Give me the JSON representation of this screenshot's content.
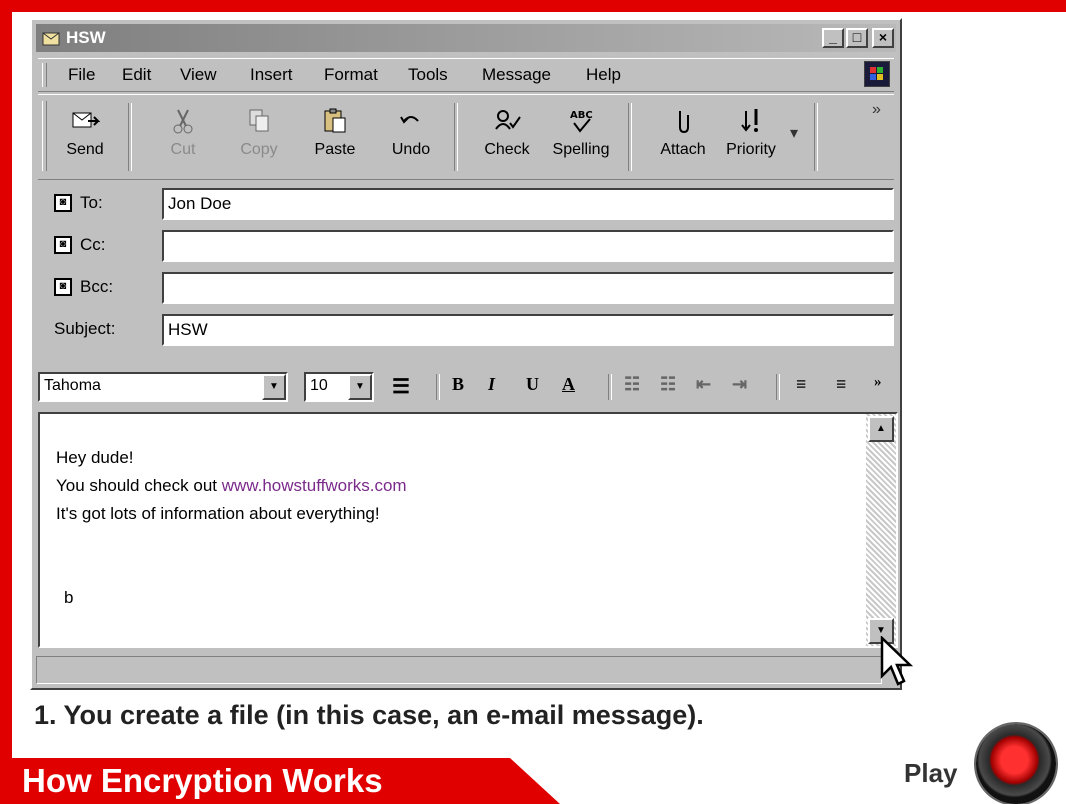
{
  "window": {
    "title": "HSW",
    "min_label": "_",
    "max_label": "□",
    "close_label": "×"
  },
  "menu": [
    "File",
    "Edit",
    "View",
    "Insert",
    "Format",
    "Tools",
    "Message",
    "Help"
  ],
  "toolbar": {
    "send": "Send",
    "cut": "Cut",
    "copy": "Copy",
    "paste": "Paste",
    "undo": "Undo",
    "check": "Check",
    "spelling": "Spelling",
    "attach": "Attach",
    "priority": "Priority"
  },
  "header": {
    "to_label": "To:",
    "to_value": "Jon Doe",
    "cc_label": "Cc:",
    "cc_value": "",
    "bcc_label": "Bcc:",
    "bcc_value": "",
    "subject_label": "Subject:",
    "subject_value": "HSW"
  },
  "format": {
    "font": "Tahoma",
    "size": "10",
    "bold": "B",
    "italic": "I",
    "underline": "U",
    "font_color": "A"
  },
  "message": {
    "line1": "Hey dude!",
    "line2_prefix": "You should check out ",
    "line2_link": "www.howstuffworks.com",
    "line3": "It's got lots of information about everything!",
    "line4": "b"
  },
  "caption": "1. You create a file (in this case, an e-mail message).",
  "banner": "How Encryption Works",
  "play_label": "Play",
  "colors": {
    "frame_red": "#e00000",
    "window_gray": "#c0c0c0",
    "link_purple": "#7a2a8a"
  }
}
